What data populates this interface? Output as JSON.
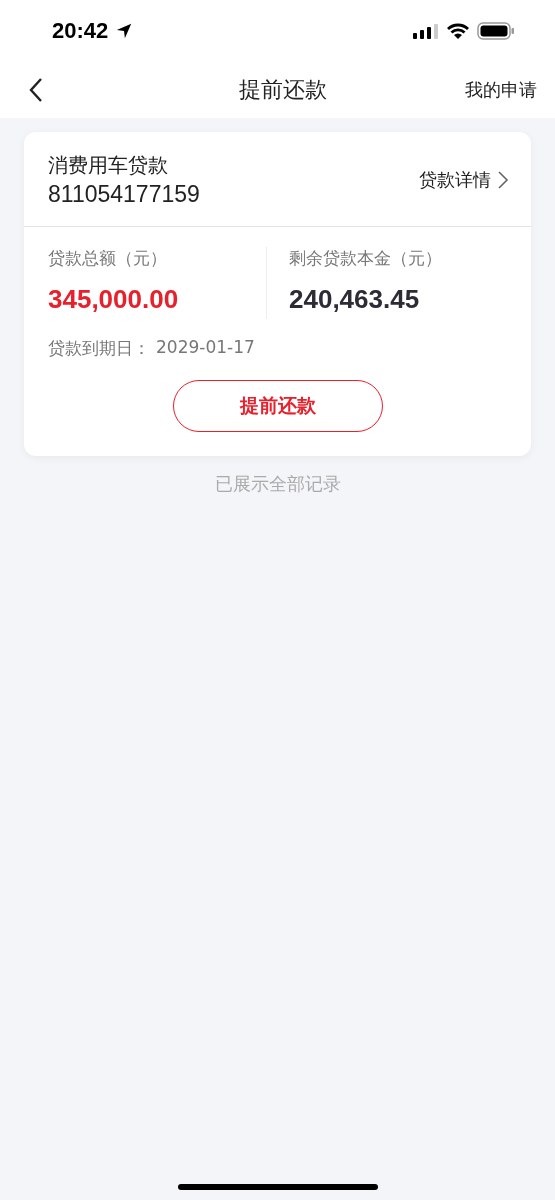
{
  "status_bar": {
    "time": "20:42"
  },
  "nav": {
    "title": "提前还款",
    "action": "我的申请"
  },
  "loan": {
    "name": "消费用车贷款",
    "number": "811054177159",
    "details_link": "贷款详情",
    "figures": [
      {
        "label": "贷款总额（元）",
        "value": "345,000.00",
        "color": "#e8202b"
      },
      {
        "label": "剩余贷款本金（元）",
        "value": "240,463.45",
        "color": "#2b2c36"
      }
    ],
    "due_label": "贷款到期日：",
    "due_date": "2029-01-17",
    "button": "提前还款"
  },
  "footer_note": "已展示全部记录"
}
